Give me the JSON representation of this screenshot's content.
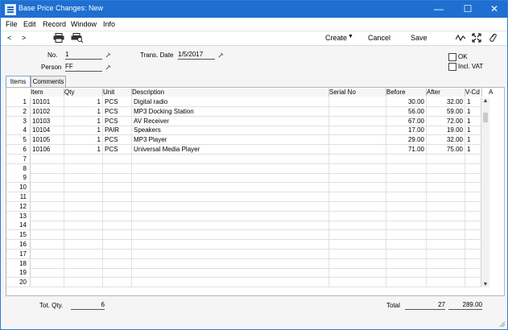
{
  "window": {
    "title": "Base Price Changes: New",
    "controls": {
      "minimize": "—",
      "maximize": "☐",
      "close": "✕"
    }
  },
  "menubar": {
    "items": [
      "File",
      "Edit",
      "Record",
      "Window",
      "Info"
    ]
  },
  "toolbar": {
    "back": "<",
    "forward": ">",
    "create_label": "Create",
    "cancel_label": "Cancel",
    "save_label": "Save"
  },
  "header": {
    "no_label": "No.",
    "no_value": "1",
    "person_label": "Person",
    "person_value": "FF",
    "trans_date_label": "Trans. Date",
    "trans_date_value": "1/5/2017",
    "ok_label": "OK",
    "incl_vat_label": "Incl. VAT"
  },
  "tabs": [
    {
      "label": "Items",
      "active": true
    },
    {
      "label": "Comments",
      "active": false
    }
  ],
  "grid": {
    "columns": [
      "Item",
      "Qty",
      "Unit",
      "Description",
      "Serial No",
      "Before",
      "After",
      "V-Cd",
      "A"
    ],
    "row_numbers": [
      "1",
      "2",
      "3",
      "4",
      "5",
      "6",
      "7",
      "8",
      "9",
      "10",
      "11",
      "12",
      "13",
      "14",
      "15",
      "16",
      "17",
      "18",
      "19",
      "20"
    ],
    "rows": [
      {
        "item": "10101",
        "qty": "1",
        "unit": "PCS",
        "description": "Digital radio",
        "serial": "",
        "before": "30.00",
        "after": "32.00",
        "vcd": "1"
      },
      {
        "item": "10102",
        "qty": "1",
        "unit": "PCS",
        "description": "MP3 Docking Station",
        "serial": "",
        "before": "56.00",
        "after": "59.00",
        "vcd": "1"
      },
      {
        "item": "10103",
        "qty": "1",
        "unit": "PCS",
        "description": "AV Receiver",
        "serial": "",
        "before": "67.00",
        "after": "72.00",
        "vcd": "1"
      },
      {
        "item": "10104",
        "qty": "1",
        "unit": "PAIR",
        "description": "Speakers",
        "serial": "",
        "before": "17.00",
        "after": "19.00",
        "vcd": "1"
      },
      {
        "item": "10105",
        "qty": "1",
        "unit": "PCS",
        "description": "MP3 Player",
        "serial": "",
        "before": "29.00",
        "after": "32.00",
        "vcd": "1"
      },
      {
        "item": "10106",
        "qty": "1",
        "unit": "PCS",
        "description": "Universal Media Player",
        "serial": "",
        "before": "71.00",
        "after": "75.00",
        "vcd": "1"
      }
    ]
  },
  "footer": {
    "tot_qty_label": "Tot. Qty.",
    "tot_qty_value": "6",
    "total_label": "Total",
    "total_before": "27",
    "total_after": "289.00"
  },
  "colors": {
    "titlebar": "#1f6fd1",
    "window_border": "#2b7bd6"
  }
}
